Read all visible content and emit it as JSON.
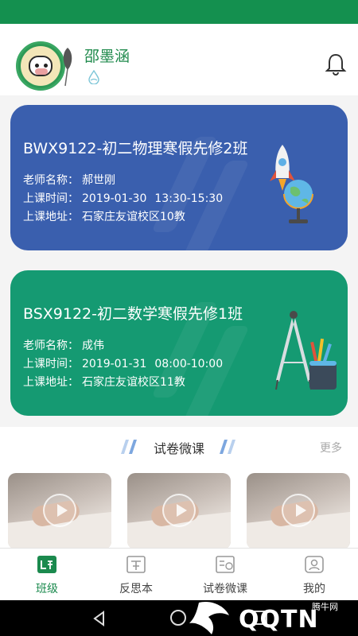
{
  "profile": {
    "name": "邵墨涵"
  },
  "classes": [
    {
      "title": "BWX9122-初二物理寒假先修2班",
      "teacher_label": "老师名称：",
      "teacher": "郝世刚",
      "time_label": "上课时间：",
      "date": "2019-01-30",
      "time": "13:30-15:30",
      "address_label": "上课地址：",
      "address": "石家庄友谊校区10教",
      "color": "#3a5fae",
      "art_icon": "rocket-globe-icon"
    },
    {
      "title": "BSX9122-初二数学寒假先修1班",
      "teacher_label": "老师名称：",
      "teacher": "成伟",
      "time_label": "上课时间：",
      "date": "2019-01-31",
      "time": "08:00-10:00",
      "address_label": "上课地址：",
      "address": "石家庄友谊校区11教",
      "color": "#159a72",
      "art_icon": "compass-pencil-cup-icon"
    }
  ],
  "section": {
    "title": "试卷微课",
    "more": "更多"
  },
  "tabs": [
    {
      "label": "班级",
      "icon": "class-icon",
      "active": true
    },
    {
      "label": "反思本",
      "icon": "notebook-icon",
      "active": false
    },
    {
      "label": "试卷微课",
      "icon": "exam-video-icon",
      "active": false
    },
    {
      "label": "我的",
      "icon": "profile-icon",
      "active": false
    }
  ],
  "watermark": {
    "brand": "QQTN",
    "sub": "腾牛网"
  },
  "colors": {
    "accent": "#14904f",
    "card_blue": "#3a5fae",
    "card_green": "#159a72"
  }
}
